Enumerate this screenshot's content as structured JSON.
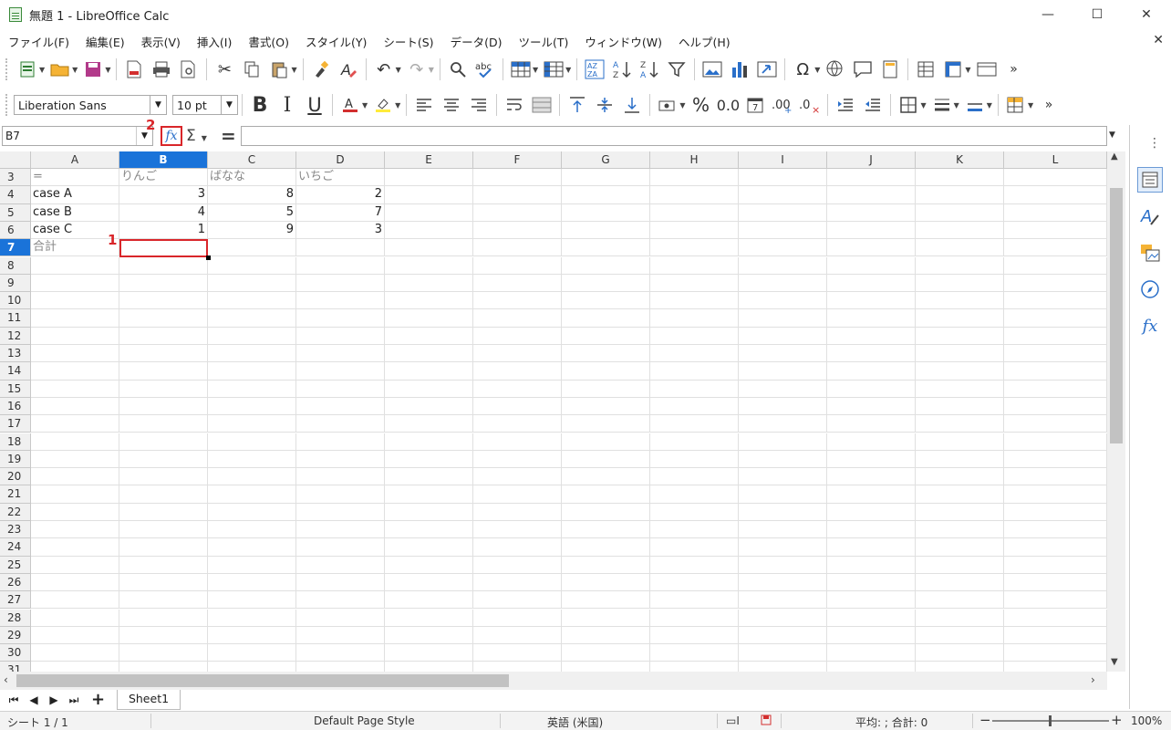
{
  "window": {
    "title": "無題 1 - LibreOffice Calc",
    "minimize": "—",
    "maximize": "☐",
    "close": "✕"
  },
  "menu": {
    "items": [
      "ファイル(F)",
      "編集(E)",
      "表示(V)",
      "挿入(I)",
      "書式(O)",
      "スタイル(Y)",
      "シート(S)",
      "データ(D)",
      "ツール(T)",
      "ウィンドウ(W)",
      "ヘルプ(H)"
    ],
    "close": "✕"
  },
  "format_toolbar": {
    "font_name": "Liberation Sans",
    "font_size": "10 pt"
  },
  "formula_bar": {
    "name_box": "B7",
    "fx_symbol": "fx",
    "sum_symbol": "Σ",
    "equals_symbol": "=",
    "formula_value": ""
  },
  "annotations": {
    "step1": "1",
    "step2": "2"
  },
  "grid": {
    "columns": [
      "A",
      "B",
      "C",
      "D",
      "E",
      "F",
      "G",
      "H",
      "I",
      "J",
      "K",
      "L"
    ],
    "selected_column": "B",
    "selected_row": "7",
    "rows": [
      {
        "num": "3",
        "cells": [
          "=",
          "りんご",
          "ばなな",
          "いちご"
        ]
      },
      {
        "num": "4",
        "cells": [
          "case A",
          "3",
          "8",
          "2"
        ]
      },
      {
        "num": "5",
        "cells": [
          "case B",
          "4",
          "5",
          "7"
        ]
      },
      {
        "num": "6",
        "cells": [
          "case C",
          "1",
          "9",
          "3"
        ]
      },
      {
        "num": "7",
        "cells": [
          "合計",
          "",
          "",
          ""
        ]
      },
      {
        "num": "8",
        "cells": []
      },
      {
        "num": "9",
        "cells": []
      },
      {
        "num": "10",
        "cells": []
      },
      {
        "num": "11",
        "cells": []
      },
      {
        "num": "12",
        "cells": []
      },
      {
        "num": "13",
        "cells": []
      },
      {
        "num": "14",
        "cells": []
      },
      {
        "num": "15",
        "cells": []
      },
      {
        "num": "16",
        "cells": []
      },
      {
        "num": "17",
        "cells": []
      },
      {
        "num": "18",
        "cells": []
      },
      {
        "num": "19",
        "cells": []
      },
      {
        "num": "20",
        "cells": []
      },
      {
        "num": "21",
        "cells": []
      },
      {
        "num": "22",
        "cells": []
      },
      {
        "num": "23",
        "cells": []
      },
      {
        "num": "24",
        "cells": []
      },
      {
        "num": "25",
        "cells": []
      },
      {
        "num": "26",
        "cells": []
      },
      {
        "num": "27",
        "cells": []
      },
      {
        "num": "28",
        "cells": []
      },
      {
        "num": "29",
        "cells": []
      },
      {
        "num": "30",
        "cells": []
      },
      {
        "num": "31",
        "cells": []
      }
    ]
  },
  "sheets": {
    "active": "Sheet1",
    "add": "+"
  },
  "status": {
    "sheet_info": "シート 1 / 1",
    "page_style": "Default Page Style",
    "language": "英語 (米国)",
    "summary": "平均: ; 合計: 0",
    "zoom": "100%",
    "zoom_minus": "−",
    "zoom_plus": "+"
  },
  "colors": {
    "accent": "#1a73d9",
    "highlight": "#d9262a"
  }
}
